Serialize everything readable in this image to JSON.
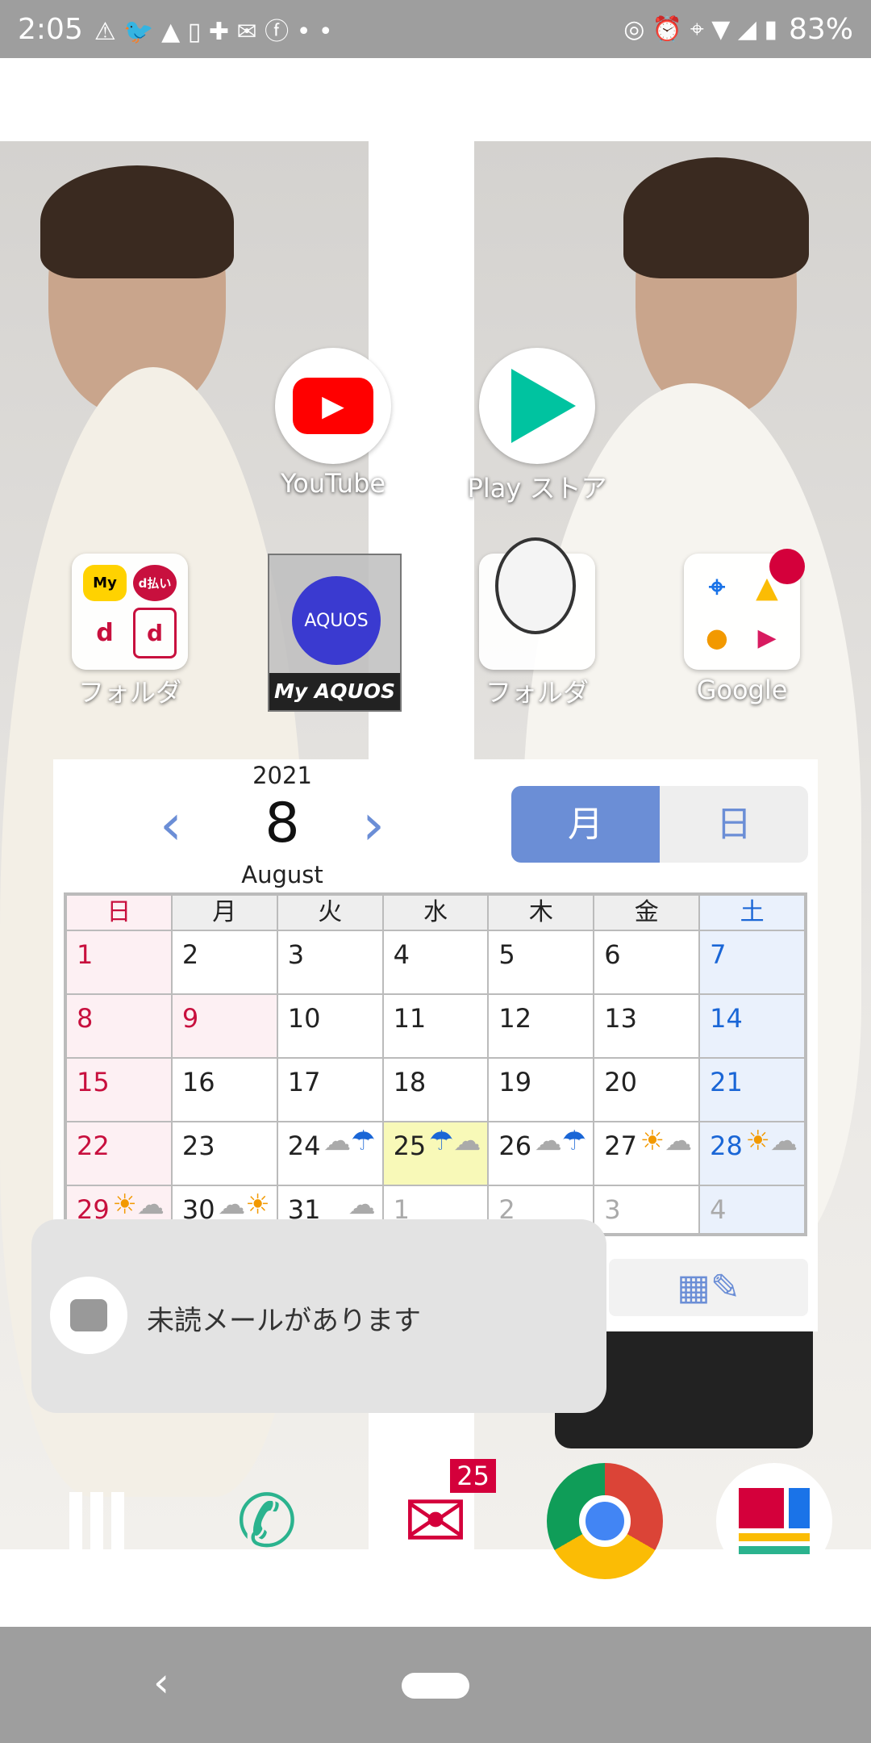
{
  "status_bar": {
    "time": "2:05",
    "battery": "83%",
    "icons": [
      "warning-icon",
      "twitter-icon",
      "gallery-icon",
      "phone-app-icon",
      "plus-icon",
      "mail-download-icon",
      "facebook-icon",
      "more-dots-icon",
      "nfc-icon",
      "alarm-icon",
      "location-icon",
      "wifi-icon",
      "signal-icon",
      "battery-icon"
    ]
  },
  "apps": [
    {
      "label": "YouTube"
    },
    {
      "label": "Play ストア"
    },
    {
      "label": "フォルダ"
    },
    {
      "label": "My AQUOS",
      "inner": "AQUOS"
    },
    {
      "label": "フォルダ"
    },
    {
      "label": "Google"
    }
  ],
  "folder1": [
    "My",
    "d払い",
    "d",
    "d"
  ],
  "calendar": {
    "year": "2021",
    "month": "8",
    "month_name": "August",
    "toggle": [
      "月",
      "日"
    ],
    "weekdays": [
      "日",
      "月",
      "火",
      "水",
      "木",
      "金",
      "土"
    ],
    "weeks": [
      [
        {
          "d": "1",
          "t": "sun"
        },
        {
          "d": "2"
        },
        {
          "d": "3"
        },
        {
          "d": "4"
        },
        {
          "d": "5"
        },
        {
          "d": "6"
        },
        {
          "d": "7",
          "t": "sat"
        }
      ],
      [
        {
          "d": "8",
          "t": "sun"
        },
        {
          "d": "9",
          "t": "hol"
        },
        {
          "d": "10"
        },
        {
          "d": "11"
        },
        {
          "d": "12"
        },
        {
          "d": "13"
        },
        {
          "d": "14",
          "t": "sat"
        }
      ],
      [
        {
          "d": "15",
          "t": "sun"
        },
        {
          "d": "16"
        },
        {
          "d": "17"
        },
        {
          "d": "18"
        },
        {
          "d": "19"
        },
        {
          "d": "20"
        },
        {
          "d": "21",
          "t": "sat"
        }
      ],
      [
        {
          "d": "22",
          "t": "sun"
        },
        {
          "d": "23"
        },
        {
          "d": "24",
          "w": "cloudy-rain"
        },
        {
          "d": "25",
          "t": "today",
          "w": "rain-cloudy"
        },
        {
          "d": "26",
          "w": "cloudy-rain"
        },
        {
          "d": "27",
          "w": "sunny-cloudy"
        },
        {
          "d": "28",
          "t": "sat",
          "w": "sunny-cloudy"
        }
      ],
      [
        {
          "d": "29",
          "t": "sun",
          "w": "sunny-cloudy"
        },
        {
          "d": "30",
          "w": "cloudy-sunny"
        },
        {
          "d": "31",
          "w": "cloudy"
        },
        {
          "d": "1",
          "t": "oth"
        },
        {
          "d": "2",
          "t": "oth"
        },
        {
          "d": "3",
          "t": "oth"
        },
        {
          "d": "4",
          "t": "othsat"
        }
      ]
    ]
  },
  "toast": {
    "text": "未読メールがあります"
  },
  "dock": {
    "mail_badge": "25"
  },
  "colors": {
    "accent": "#6b8ed6",
    "sunday": "#c8103e",
    "saturday": "#1a66d6",
    "today": "#f8f9b8"
  }
}
